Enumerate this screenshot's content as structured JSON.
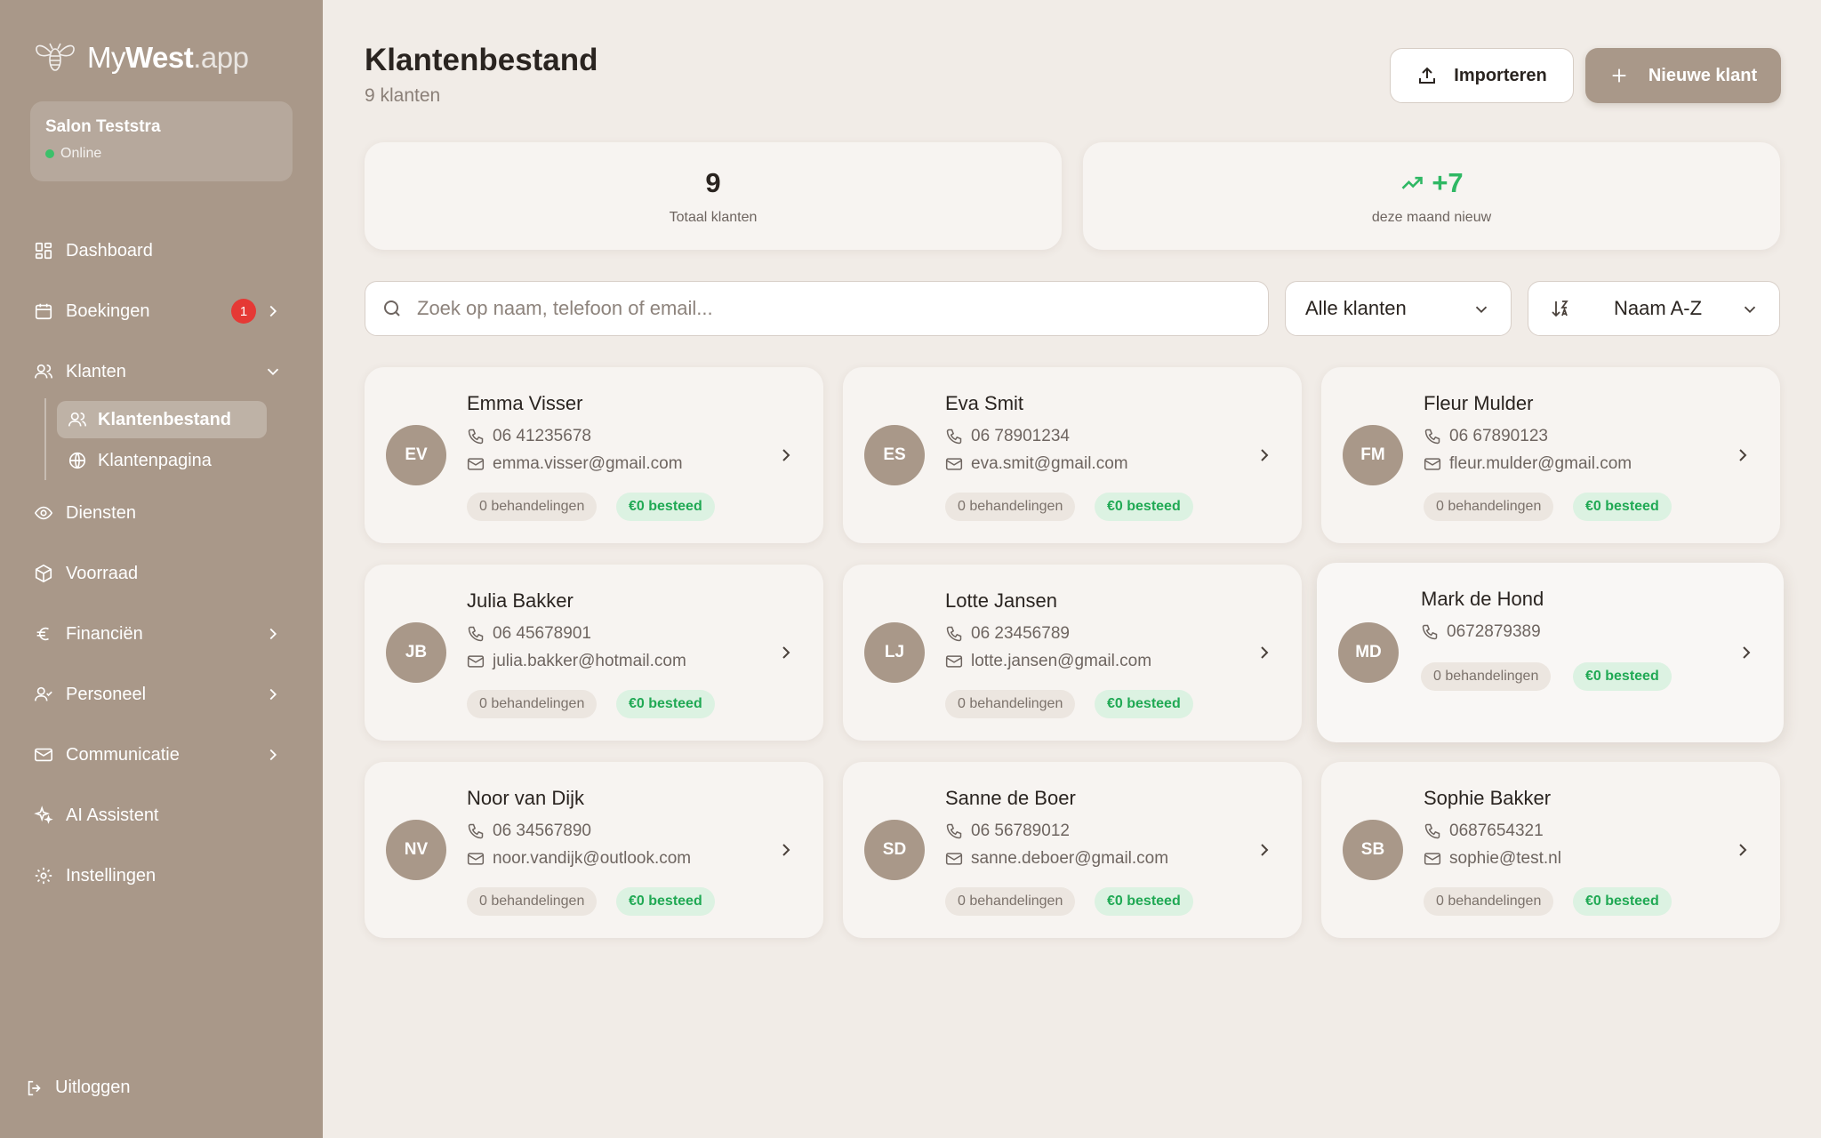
{
  "app": {
    "logo_prefix": "My",
    "logo_bold": "West",
    "logo_suffix": ".app"
  },
  "salon": {
    "name": "Salon Teststra",
    "status": "Online"
  },
  "nav": {
    "dashboard": "Dashboard",
    "boekingen": "Boekingen",
    "boekingen_badge": "1",
    "klanten": "Klanten",
    "klantenbestand": "Klantenbestand",
    "klantenpagina": "Klantenpagina",
    "diensten": "Diensten",
    "voorraad": "Voorraad",
    "financien": "Financiën",
    "personeel": "Personeel",
    "communicatie": "Communicatie",
    "ai_assistent": "AI Assistent",
    "instellingen": "Instellingen",
    "uitloggen": "Uitloggen"
  },
  "header": {
    "title": "Klantenbestand",
    "subtitle": "9 klanten",
    "import_label": "Importeren",
    "new_label": "Nieuwe klant"
  },
  "stats": {
    "total_value": "9",
    "total_label": "Totaal klanten",
    "new_value": "+7",
    "new_label": "deze maand nieuw"
  },
  "toolbar": {
    "search_placeholder": "Zoek op naam, telefoon of email...",
    "filter_value": "Alle klanten",
    "sort_value": "Naam A-Z"
  },
  "clients": [
    {
      "initials": "EV",
      "name": "Emma Visser",
      "phone": "06 41235678",
      "email": "emma.visser@gmail.com",
      "treatments": "0 behandelingen",
      "spent": "€0 besteed"
    },
    {
      "initials": "ES",
      "name": "Eva Smit",
      "phone": "06 78901234",
      "email": "eva.smit@gmail.com",
      "treatments": "0 behandelingen",
      "spent": "€0 besteed"
    },
    {
      "initials": "FM",
      "name": "Fleur Mulder",
      "phone": "06 67890123",
      "email": "fleur.mulder@gmail.com",
      "treatments": "0 behandelingen",
      "spent": "€0 besteed"
    },
    {
      "initials": "JB",
      "name": "Julia Bakker",
      "phone": "06 45678901",
      "email": "julia.bakker@hotmail.com",
      "treatments": "0 behandelingen",
      "spent": "€0 besteed"
    },
    {
      "initials": "LJ",
      "name": "Lotte Jansen",
      "phone": "06 23456789",
      "email": "lotte.jansen@gmail.com",
      "treatments": "0 behandelingen",
      "spent": "€0 besteed"
    },
    {
      "initials": "MD",
      "name": "Mark de Hond",
      "phone": "0672879389",
      "email": "",
      "treatments": "0 behandelingen",
      "spent": "€0 besteed"
    },
    {
      "initials": "NV",
      "name": "Noor van Dijk",
      "phone": "06 34567890",
      "email": "noor.vandijk@outlook.com",
      "treatments": "0 behandelingen",
      "spent": "€0 besteed"
    },
    {
      "initials": "SD",
      "name": "Sanne de Boer",
      "phone": "06 56789012",
      "email": "sanne.deboer@gmail.com",
      "treatments": "0 behandelingen",
      "spent": "€0 besteed"
    },
    {
      "initials": "SB",
      "name": "Sophie Bakker",
      "phone": "0687654321",
      "email": "sophie@test.nl",
      "treatments": "0 behandelingen",
      "spent": "€0 besteed"
    }
  ],
  "colors": {
    "sidebar": "#a99889",
    "accent_green": "#2fb864",
    "badge_red": "#e53935"
  }
}
